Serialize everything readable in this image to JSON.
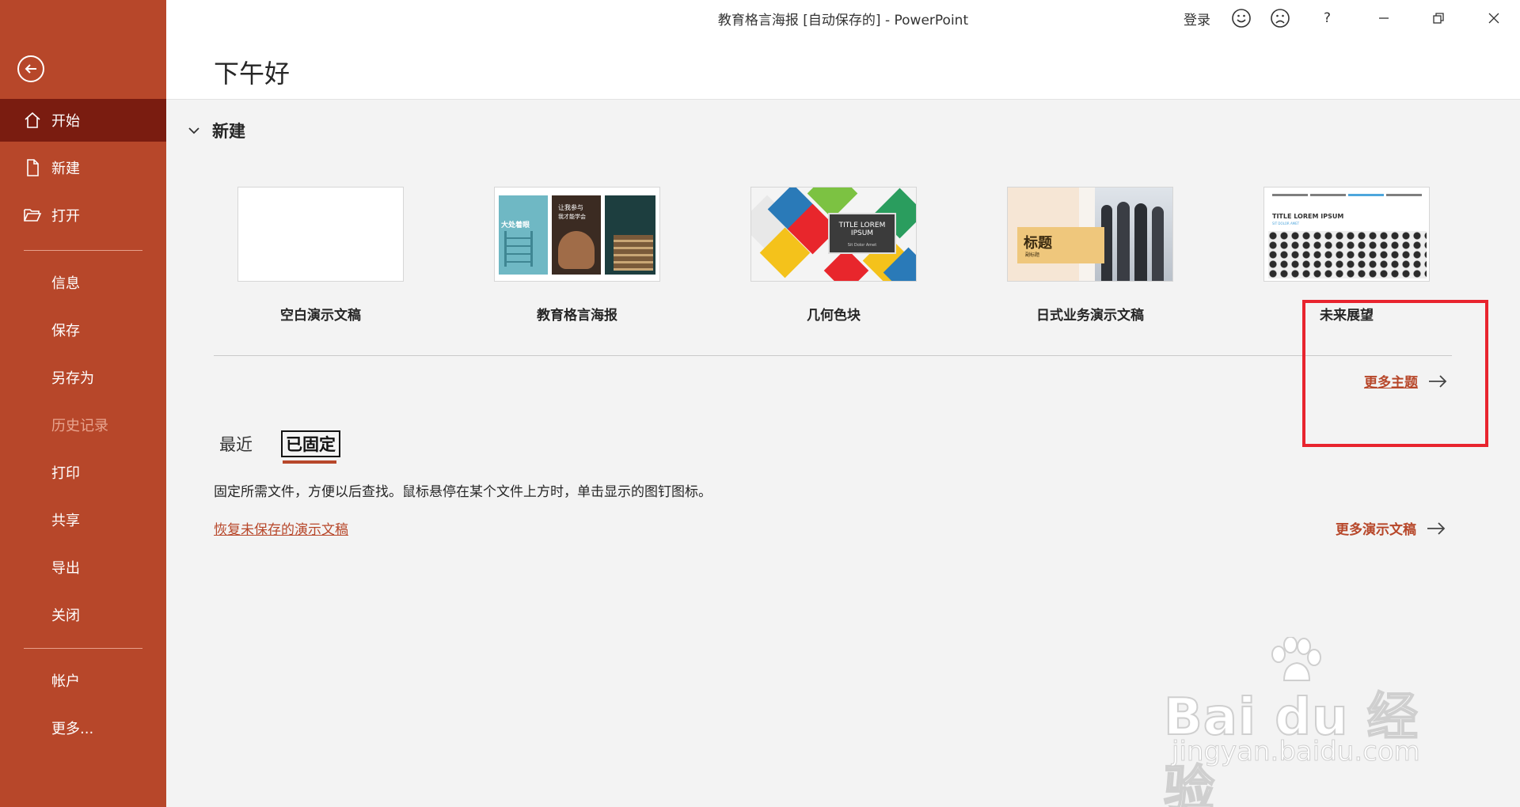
{
  "titlebar": {
    "doc_title": "教育格言海报 [自动保存的]  -  PowerPoint",
    "login": "登录",
    "help": "?",
    "icons": [
      "smile-icon",
      "frown-icon",
      "help-icon",
      "minimize-icon",
      "restore-icon",
      "close-icon"
    ]
  },
  "sidebar": {
    "items": [
      {
        "label": "开始",
        "icon": "home-icon",
        "active": true
      },
      {
        "label": "新建",
        "icon": "new-document-icon"
      },
      {
        "label": "打开",
        "icon": "open-folder-icon"
      },
      {
        "label": "信息"
      },
      {
        "label": "保存"
      },
      {
        "label": "另存为"
      },
      {
        "label": "历史记录",
        "disabled": true
      },
      {
        "label": "打印"
      },
      {
        "label": "共享"
      },
      {
        "label": "导出"
      },
      {
        "label": "关闭"
      },
      {
        "label": "帐户"
      },
      {
        "label": "更多..."
      }
    ]
  },
  "main": {
    "greeting": "下午好",
    "new_section": {
      "title": "新建",
      "templates": [
        {
          "name": "空白演示文稿"
        },
        {
          "name": "教育格言海报",
          "thumb_texts": [
            "大处着眼",
            "让我参与",
            "我才能学会"
          ]
        },
        {
          "name": "几何色块",
          "thumb_texts": [
            "TITLE LOREM IPSUM",
            "Sit Dolor Amet"
          ]
        },
        {
          "name": "日式业务演示文稿",
          "thumb_texts": [
            "标题",
            "副标题"
          ]
        },
        {
          "name": "未来展望",
          "thumb_texts": [
            "TITLE LOREM IPSUM",
            "SIT DOLOR AMET"
          ]
        }
      ],
      "more_themes": "更多主题"
    },
    "tabs": {
      "recent": "最近",
      "pinned": "已固定"
    },
    "pinned_desc": "固定所需文件，方便以后查找。鼠标悬停在某个文件上方时，单击显示的图钉图标。",
    "recover_link": "恢复未保存的演示文稿",
    "more_presentations": "更多演示文稿"
  },
  "watermark": {
    "big": "Bai du 经验",
    "small": "jingyan.baidu.com"
  },
  "colors": {
    "accent": "#b7472a",
    "sidebar_active": "#7a1c10",
    "highlight_box": "#e8242e"
  }
}
